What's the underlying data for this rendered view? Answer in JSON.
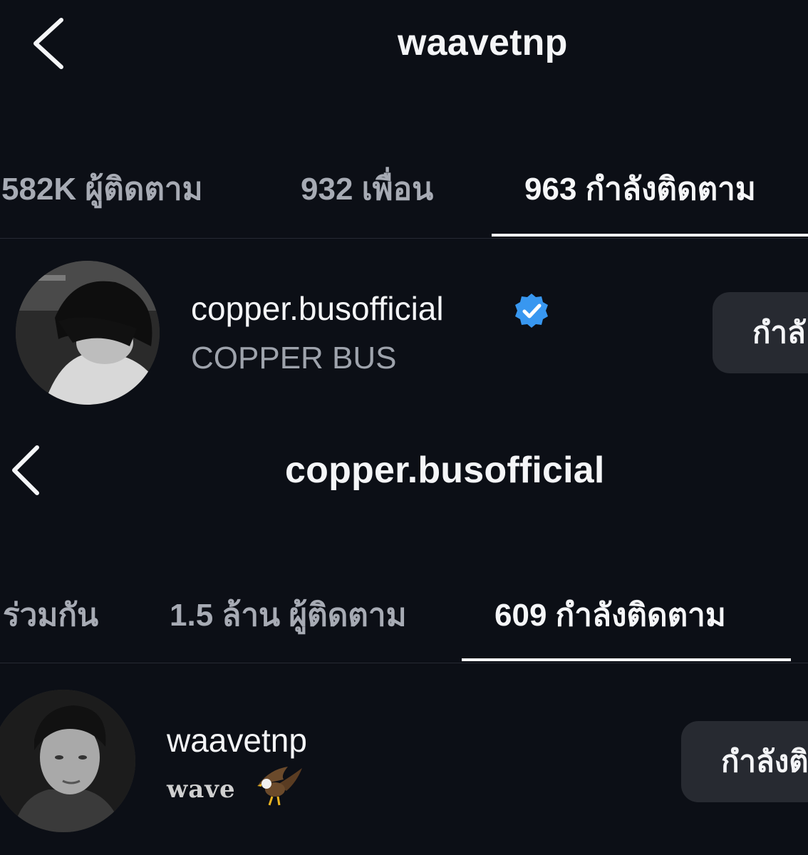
{
  "profile1": {
    "title": "waavetnp",
    "tabs": [
      {
        "label": "582K ผู้ติดตาม",
        "active": false
      },
      {
        "label": "932 เพื่อน",
        "active": false
      },
      {
        "label": "963 กำลังติดตาม",
        "active": true
      }
    ],
    "row": {
      "username": "copper.busofficial",
      "verified": true,
      "full_name": "COPPER BUS",
      "button_label": "กำลั"
    }
  },
  "profile2": {
    "title": "copper.busofficial",
    "tabs": [
      {
        "label": "ร่วมกัน",
        "active": false
      },
      {
        "label": "1.5 ล้าน ผู้ติดตาม",
        "active": false
      },
      {
        "label": "609 กำลังติดตาม",
        "active": true
      }
    ],
    "row": {
      "username": "waavetnp",
      "bio": "wave",
      "bio_emoji": "eagle-emoji",
      "button_label": "กำลังติ"
    }
  },
  "colors": {
    "background": "#0c0f16",
    "verified_badge": "#3897f0",
    "button_bg": "#272a31"
  }
}
